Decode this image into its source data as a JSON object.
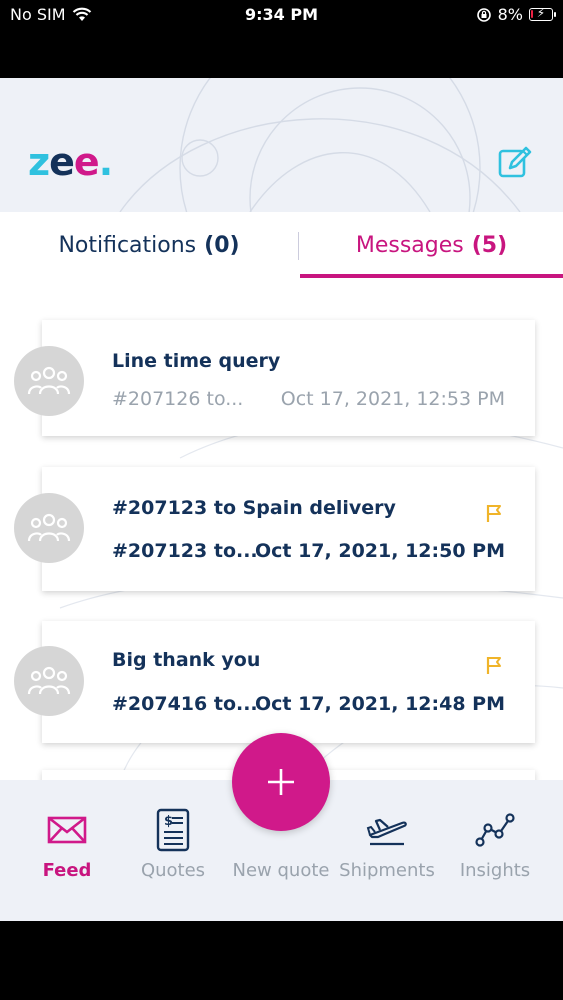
{
  "status_bar": {
    "carrier": "No SIM",
    "time": "9:34 PM",
    "battery_percent": "8%",
    "battery_level": 0.08
  },
  "header": {
    "logo_text": "zee.",
    "compose_icon": "compose-icon"
  },
  "tabs": [
    {
      "label": "Notifications",
      "count": "(0)",
      "active": false
    },
    {
      "label": "Messages",
      "count": "(5)",
      "active": true
    }
  ],
  "messages": [
    {
      "title": "Line time query",
      "ref": "#207126 to...",
      "date": "Oct 17, 2021, 12:53 PM",
      "flagged": false,
      "unread": false
    },
    {
      "title": "#207123 to Spain delivery",
      "ref": "#207123 to...",
      "date": "Oct 17, 2021, 12:50 PM",
      "flagged": true,
      "unread": true
    },
    {
      "title": "Big thank you",
      "ref": "#207416 to...",
      "date": "Oct 17, 2021, 12:48 PM",
      "flagged": true,
      "unread": true
    }
  ],
  "bottom_nav": [
    {
      "label": "Feed",
      "icon": "envelope-icon",
      "active": true
    },
    {
      "label": "Quotes",
      "icon": "document-dollar-icon",
      "active": false
    },
    {
      "label": "New quote",
      "icon": "plus-icon",
      "active": false
    },
    {
      "label": "Shipments",
      "icon": "airplane-icon",
      "active": false
    },
    {
      "label": "Insights",
      "icon": "insights-graph-icon",
      "active": false
    }
  ],
  "colors": {
    "brand_pink": "#d0198a",
    "brand_navy": "#14325a",
    "brand_cyan": "#2fc1df",
    "flag_yellow": "#f0b429",
    "muted_gray": "#9aa3ad"
  }
}
